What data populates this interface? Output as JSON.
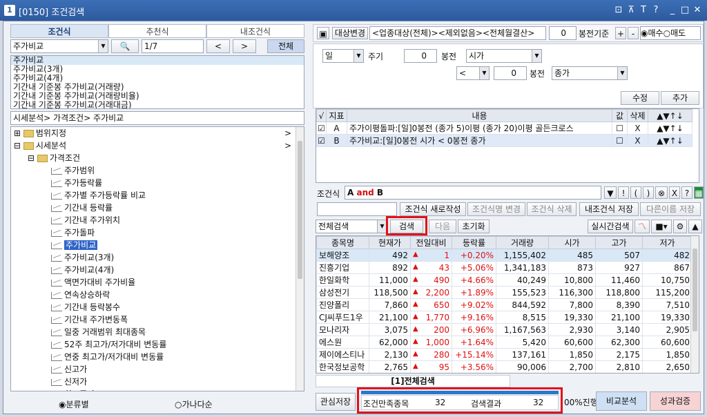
{
  "window": {
    "number": "1",
    "title": "[0150] 조건검색",
    "buttons": [
      "⊡",
      "⊼",
      "T",
      "?",
      "_",
      "□",
      "✕"
    ]
  },
  "left": {
    "tabs": [
      "조건식",
      "추천식",
      "내조건식"
    ],
    "select_value": "주가비교",
    "counter": "1/7",
    "prev": "<",
    "next": ">",
    "all": "전체",
    "list": [
      "주가비교",
      "주가비교(3개)",
      "주가비교(4개)",
      "기간내 기준봉 주가비교(거래량)",
      "기간내 기준봉 주가비교(거래량비율)",
      "기간내 기준봉 주가비교(거래대금)"
    ],
    "path": "시세분석> 가격조건> 주가비교",
    "tree_top": [
      {
        "label": "범위지정",
        "arrow": ">"
      },
      {
        "label": "시세분석",
        "arrow": ">"
      }
    ],
    "tree_folder": "가격조건",
    "tree_items": [
      "주가범위",
      "주가등락률",
      "주가별 주가등락률 비교",
      "기간내 등락률",
      "기간내 주가위치",
      "주가돌파",
      "주가비교",
      "주가비교(3개)",
      "주가비교(4개)",
      "액면가대비 주가비율",
      "연속상승하락",
      "기간내 등락봉수",
      "기간내 주가변동폭",
      "일중 거래범위 최대종목",
      "52주 최고가/저가대비 변동률",
      "연중 최고가/저가대비 변동률",
      "신고가",
      "신저가",
      "최고종가"
    ],
    "radio1": "분류별",
    "radio2": "가나다순"
  },
  "right": {
    "target_label": "대상변경",
    "target_value": "<업종대상(전체)><제외없음><전체월결산>",
    "base_num": "0",
    "base_label": "봉전기준",
    "plus": "+",
    "minus": "-",
    "buy": "매수",
    "sell": "매도",
    "period_value": "일",
    "period_label": "주기",
    "n1": "0",
    "bong1": "봉전",
    "price1": "시가",
    "op": "<",
    "n2": "0",
    "bong2": "봉전",
    "price2": "종가",
    "edit": "수정",
    "add": "추가",
    "cond_headers": [
      "√",
      "지표",
      "내용",
      "값",
      "삭제",
      "▲▼↑↓"
    ],
    "cond_rows": [
      {
        "id": "A",
        "content": "주가이평돌파:[일]0봉전 (종가 5)이평 (종가 20)이평 골든크로스",
        "del": "X",
        "ctrl": "▲▼↑↓"
      },
      {
        "id": "B",
        "content": "주가비교:[일]0봉전 시가 < 0봉전 종가",
        "del": "X",
        "ctrl": "▲▼↑↓"
      }
    ],
    "expr_label": "조건식",
    "expr_a": "A",
    "expr_and": "and",
    "expr_b": "B",
    "expr_buttons": [
      "▼",
      "!",
      "(",
      ")",
      "⊗",
      "X",
      "?"
    ],
    "new_write": "조건식 새로작성",
    "name_change": "조건식명 변경",
    "cond_delete": "조건식 삭제",
    "my_save": "내조건식 저장",
    "save_as": "다른이름 저장",
    "search_type": "전체검색",
    "search": "검색",
    "next": "다음",
    "reset": "초기화",
    "realtime": "실시간검색",
    "grid_headers": [
      "종목명",
      "현재가",
      "전일대비",
      "등락률",
      "거래량",
      "시가",
      "고가",
      "저가"
    ],
    "grid_rows": [
      [
        "보해양조",
        "492",
        "1",
        "+0.20%",
        "1,155,402",
        "485",
        "507",
        "482"
      ],
      [
        "진흥기업",
        "892",
        "43",
        "+5.06%",
        "1,341,183",
        "873",
        "927",
        "867"
      ],
      [
        "한일화학",
        "11,000",
        "490",
        "+4.66%",
        "40,249",
        "10,800",
        "11,460",
        "10,750"
      ],
      [
        "삼성전기",
        "118,500",
        "2,200",
        "+1.89%",
        "155,523",
        "116,300",
        "118,800",
        "115,200"
      ],
      [
        "진양폴리",
        "7,860",
        "650",
        "+9.02%",
        "844,592",
        "7,800",
        "8,390",
        "7,510"
      ],
      [
        "CJ씨푸드1우",
        "21,100",
        "1,770",
        "+9.16%",
        "8,515",
        "19,330",
        "21,100",
        "19,330"
      ],
      [
        "모나리자",
        "3,075",
        "200",
        "+6.96%",
        "1,167,563",
        "2,930",
        "3,140",
        "2,905"
      ],
      [
        "에스원",
        "62,000",
        "1,000",
        "+1.64%",
        "5,420",
        "60,600",
        "62,300",
        "60,600"
      ],
      [
        "제이에스티나",
        "2,130",
        "280",
        "+15.14%",
        "137,161",
        "1,850",
        "2,175",
        "1,850"
      ],
      [
        "한국정보공학",
        "2,765",
        "95",
        "+3.56%",
        "90,006",
        "2,700",
        "2,810",
        "2,650"
      ]
    ],
    "result_tab": "[1]전체검색",
    "interest_save": "관심저장",
    "cond_count_label": "조건만족종목",
    "cond_count": "32",
    "result_label": "검색결과",
    "result_count": "32",
    "progress": "00%진행",
    "progress_value": 1.0,
    "compare": "비교분석",
    "perf": "성과검증"
  }
}
